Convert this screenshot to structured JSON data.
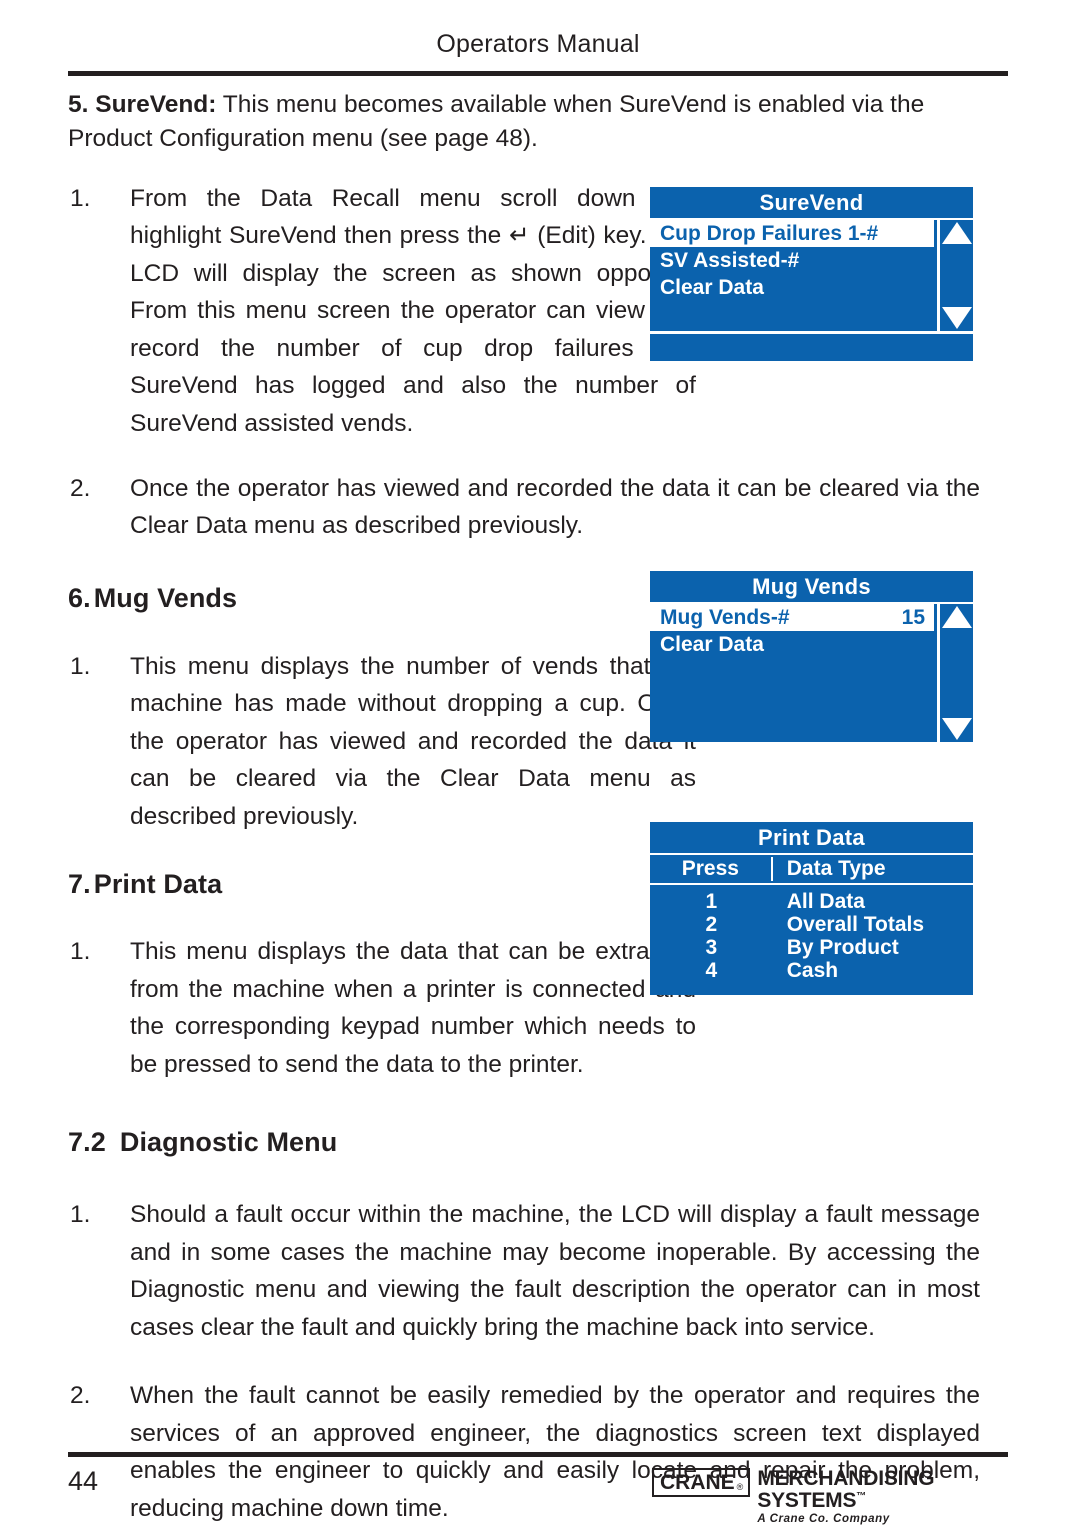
{
  "header": {
    "title": "Operators Manual"
  },
  "intro": {
    "number": "5. SureVend:",
    "text": " This menu becomes available when SureVend is enabled via the Product Configuration menu (see page 48)."
  },
  "sections": {
    "surevend_item1": {
      "num": "1.",
      "text": "From the Data Recall menu scroll down and highlight SureVend then press the ↵ (Edit) key. The LCD will display the screen as shown opposite. From this menu screen the operator can view and record the number of cup drop failures that SureVend has logged and also the number of SureVend assisted vends."
    },
    "surevend_item2": {
      "num": "2.",
      "text": "Once the operator has viewed and recorded the data it can be cleared via the Clear Data menu as described previously."
    },
    "mug_vends_heading": {
      "number": "6.",
      "label": "Mug Vends"
    },
    "mug_vends_item1": {
      "num": "1.",
      "text": "This menu displays the number of vends that the machine has made without dropping a cup. Once the operator has viewed and recorded the data it can be cleared via the Clear Data menu as described previously."
    },
    "print_data_heading": {
      "number": "7.",
      "label": "Print Data"
    },
    "print_data_item1": {
      "num": "1.",
      "text": "This menu displays the data that can be extracted from the machine when a printer is connected and the corresponding keypad number which needs to be pressed to send the data to the printer."
    },
    "diagnostic_heading": {
      "number": "7.2",
      "label": "Diagnostic Menu"
    },
    "diagnostic_item1": {
      "num": "1.",
      "text": "Should a fault occur within the machine, the LCD will display a fault message and in some cases the machine may become inoperable. By accessing the Diagnostic menu and viewing the fault description the operator can in most cases clear the fault and quickly bring the machine back into service."
    },
    "diagnostic_item2": {
      "num": "2.",
      "text": "When the fault cannot be easily remedied by the operator and requires the services of an approved engineer, the diagnostics screen text displayed enables the engineer to quickly and easily locate and repair the problem, reducing machine down time."
    }
  },
  "lcd_surevend": {
    "title": "SureVend",
    "rows": [
      {
        "label": "Cup Drop Failures 1-#",
        "value": "",
        "selected": true
      },
      {
        "label": "SV Assisted-#",
        "value": "",
        "selected": false
      },
      {
        "label": "Clear Data",
        "value": "",
        "selected": false
      }
    ],
    "scroll_up": "scroll-up",
    "scroll_down": "scroll-down"
  },
  "lcd_mug_vends": {
    "title": "Mug Vends",
    "rows": [
      {
        "label": "Mug Vends-#",
        "value": "15",
        "selected": true
      },
      {
        "label": "Clear Data",
        "value": "",
        "selected": false
      }
    ]
  },
  "lcd_print_data": {
    "title": "Print Data",
    "columns": [
      "Press",
      "Data Type"
    ],
    "rows": [
      {
        "press": "1",
        "type": "All Data"
      },
      {
        "press": "2",
        "type": "Overall Totals"
      },
      {
        "press": "3",
        "type": "By Product"
      },
      {
        "press": "4",
        "type": "Cash"
      }
    ]
  },
  "footer": {
    "page_number": "44",
    "logo_crane": "CRANE",
    "logo_registered": "®",
    "logo_merchandising": "MERCHANDISING SYSTEMS",
    "logo_tm": "™",
    "logo_tagline": "A Crane Co. Company"
  },
  "colors": {
    "lcd_blue": "#0b62ad",
    "lcd_white": "#ffffff",
    "ink": "#231f20"
  }
}
